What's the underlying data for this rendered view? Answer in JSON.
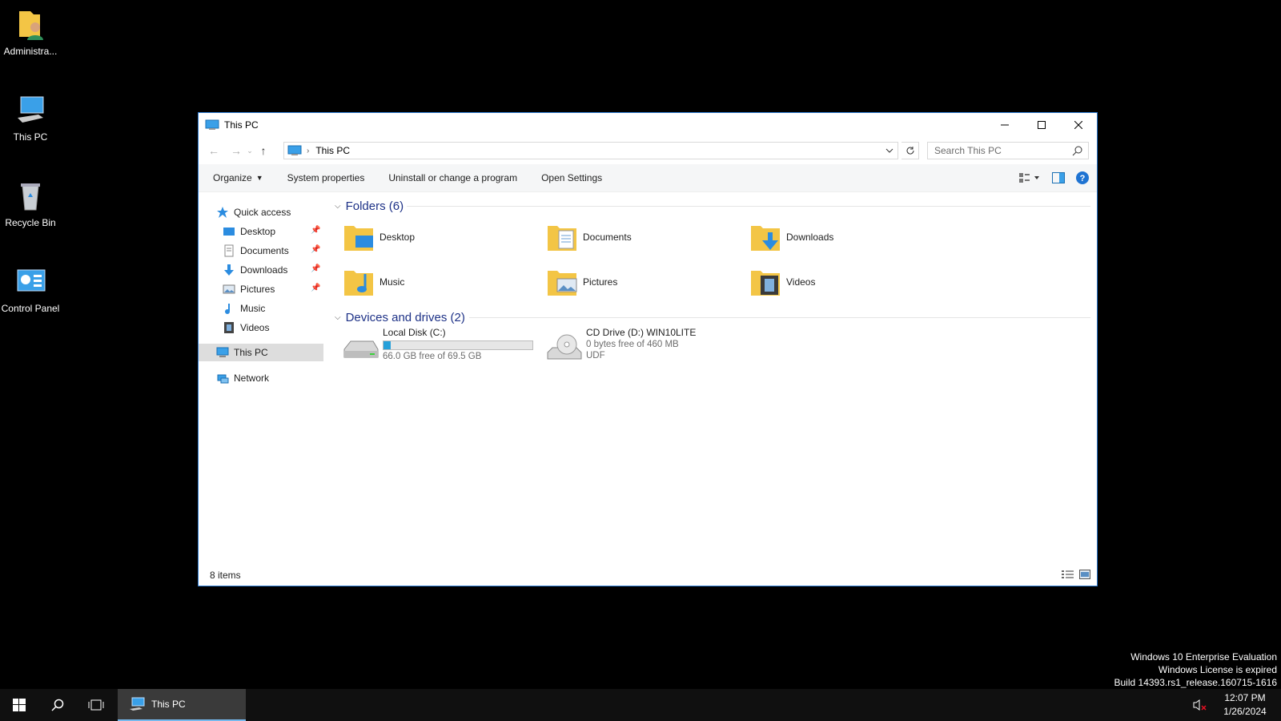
{
  "desktop": {
    "icons": [
      {
        "label": "Administra...",
        "icon": "user-folder-icon"
      },
      {
        "label": "This PC",
        "icon": "computer-icon"
      },
      {
        "label": "Recycle Bin",
        "icon": "recycle-bin-icon"
      },
      {
        "label": "Control Panel",
        "icon": "control-panel-icon"
      }
    ]
  },
  "window": {
    "title": "This PC",
    "address": {
      "crumb": "This PC"
    },
    "search": {
      "placeholder": "Search This PC"
    },
    "toolbar": {
      "organize": "Organize",
      "system_properties": "System properties",
      "uninstall": "Uninstall or change a program",
      "open_settings": "Open Settings"
    },
    "nav": {
      "quick_access": "Quick access",
      "items": [
        "Desktop",
        "Documents",
        "Downloads",
        "Pictures",
        "Music",
        "Videos"
      ],
      "this_pc": "This PC",
      "network": "Network"
    },
    "folders_header": "Folders (6)",
    "folders": [
      "Desktop",
      "Documents",
      "Downloads",
      "Music",
      "Pictures",
      "Videos"
    ],
    "drives_header": "Devices and drives (2)",
    "drives": [
      {
        "name": "Local Disk (C:)",
        "free": "66.0 GB free of 69.5 GB",
        "used_fraction": 0.05
      },
      {
        "name": "CD Drive (D:) WIN10LITE",
        "free": "0 bytes free of 460 MB",
        "fs": "UDF"
      }
    ],
    "status": "8 items",
    "accent": "#26a0da"
  },
  "watermark": {
    "line1": "Windows 10 Enterprise Evaluation",
    "line2": "Windows License is expired",
    "line3": "Build 14393.rs1_release.160715-1616"
  },
  "taskbar": {
    "app_label": "This PC",
    "time": "12:07 PM",
    "date": "1/26/2024"
  }
}
